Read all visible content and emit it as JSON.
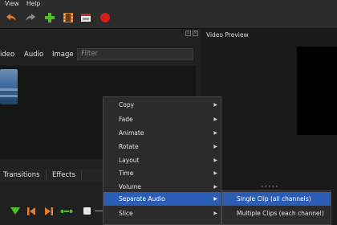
{
  "menubar": {
    "view": "View",
    "help": "Help"
  },
  "toolbar": {
    "icons": [
      "undo-icon",
      "redo-icon",
      "add-file-icon",
      "film-icon",
      "export-icon",
      "record-icon"
    ],
    "colors": {
      "undo": "#e07d2e",
      "add": "#4fbf2a",
      "record": "#d21e1e"
    }
  },
  "project": {
    "tabs": {
      "video": "ideo",
      "audio": "Audio",
      "image": "Image"
    },
    "filter_placeholder": "Filter",
    "bottom_tabs": {
      "transitions": "Transitions",
      "effects": "Effects"
    }
  },
  "preview": {
    "title": "Video Preview"
  },
  "context_menu": {
    "items": [
      {
        "label": "Copy",
        "submenu": true
      },
      {
        "label": "Fade",
        "submenu": true
      },
      {
        "label": "Animate",
        "submenu": true
      },
      {
        "label": "Rotate",
        "submenu": true
      },
      {
        "label": "Layout",
        "submenu": true
      },
      {
        "label": "Time",
        "submenu": true
      },
      {
        "label": "Volume",
        "submenu": true
      },
      {
        "label": "Separate Audio",
        "submenu": true,
        "highlighted": true
      },
      {
        "label": "Slice",
        "submenu": true
      }
    ],
    "highlight_color": "#2a5eb5"
  },
  "separate_audio_submenu": {
    "items": [
      {
        "label": "Single Clip (all channels)",
        "highlighted": true
      },
      {
        "label": "Multiple Clips (each channel)"
      }
    ]
  }
}
